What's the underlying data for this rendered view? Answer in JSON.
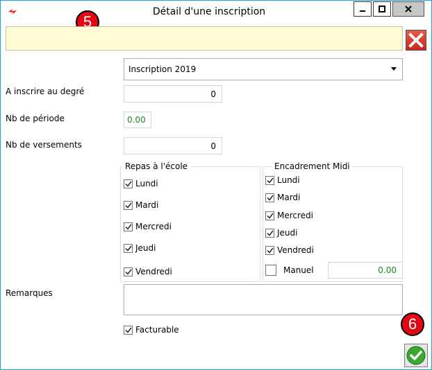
{
  "window": {
    "title": "Détail d'une inscription",
    "icons": {
      "app": "app-logo-icon",
      "minimize": "minimize-icon",
      "maximize": "maximize-icon",
      "close": "close-icon"
    }
  },
  "badges": {
    "five": "5",
    "six": "6"
  },
  "message_bar": {
    "text": "",
    "close_icon": "close-x-icon"
  },
  "form": {
    "inscription_select": {
      "value": "Inscription 2019"
    },
    "degree": {
      "label": "A inscrire au  degré",
      "value": "0"
    },
    "period": {
      "label": "Nb de période",
      "value": "0.00"
    },
    "payments": {
      "label": "Nb de versements",
      "value": "0"
    },
    "repas": {
      "title": "Repas à l'école",
      "items": [
        {
          "label": "Lundi",
          "checked": true
        },
        {
          "label": "Mardi",
          "checked": true
        },
        {
          "label": "Mercredi",
          "checked": true
        },
        {
          "label": "Jeudi",
          "checked": true
        },
        {
          "label": "Vendredi",
          "checked": true
        }
      ]
    },
    "encadrement": {
      "title": "Encadrement Midi",
      "items": [
        {
          "label": "Lundi",
          "checked": true
        },
        {
          "label": "Mardi",
          "checked": true
        },
        {
          "label": "Mercredi",
          "checked": true
        },
        {
          "label": "Jeudi",
          "checked": true
        },
        {
          "label": "Vendredi",
          "checked": true
        }
      ],
      "manual": {
        "label": "Manuel",
        "checked": false,
        "value": "0.00"
      }
    },
    "remarks": {
      "label": "Remarques",
      "value": ""
    },
    "facturable": {
      "label": "Facturable",
      "checked": true
    }
  },
  "colors": {
    "accent": "#1aa1e2",
    "badge": "#e30613",
    "value_green": "#1a8a1a",
    "message_bg": "#fffcd6"
  }
}
